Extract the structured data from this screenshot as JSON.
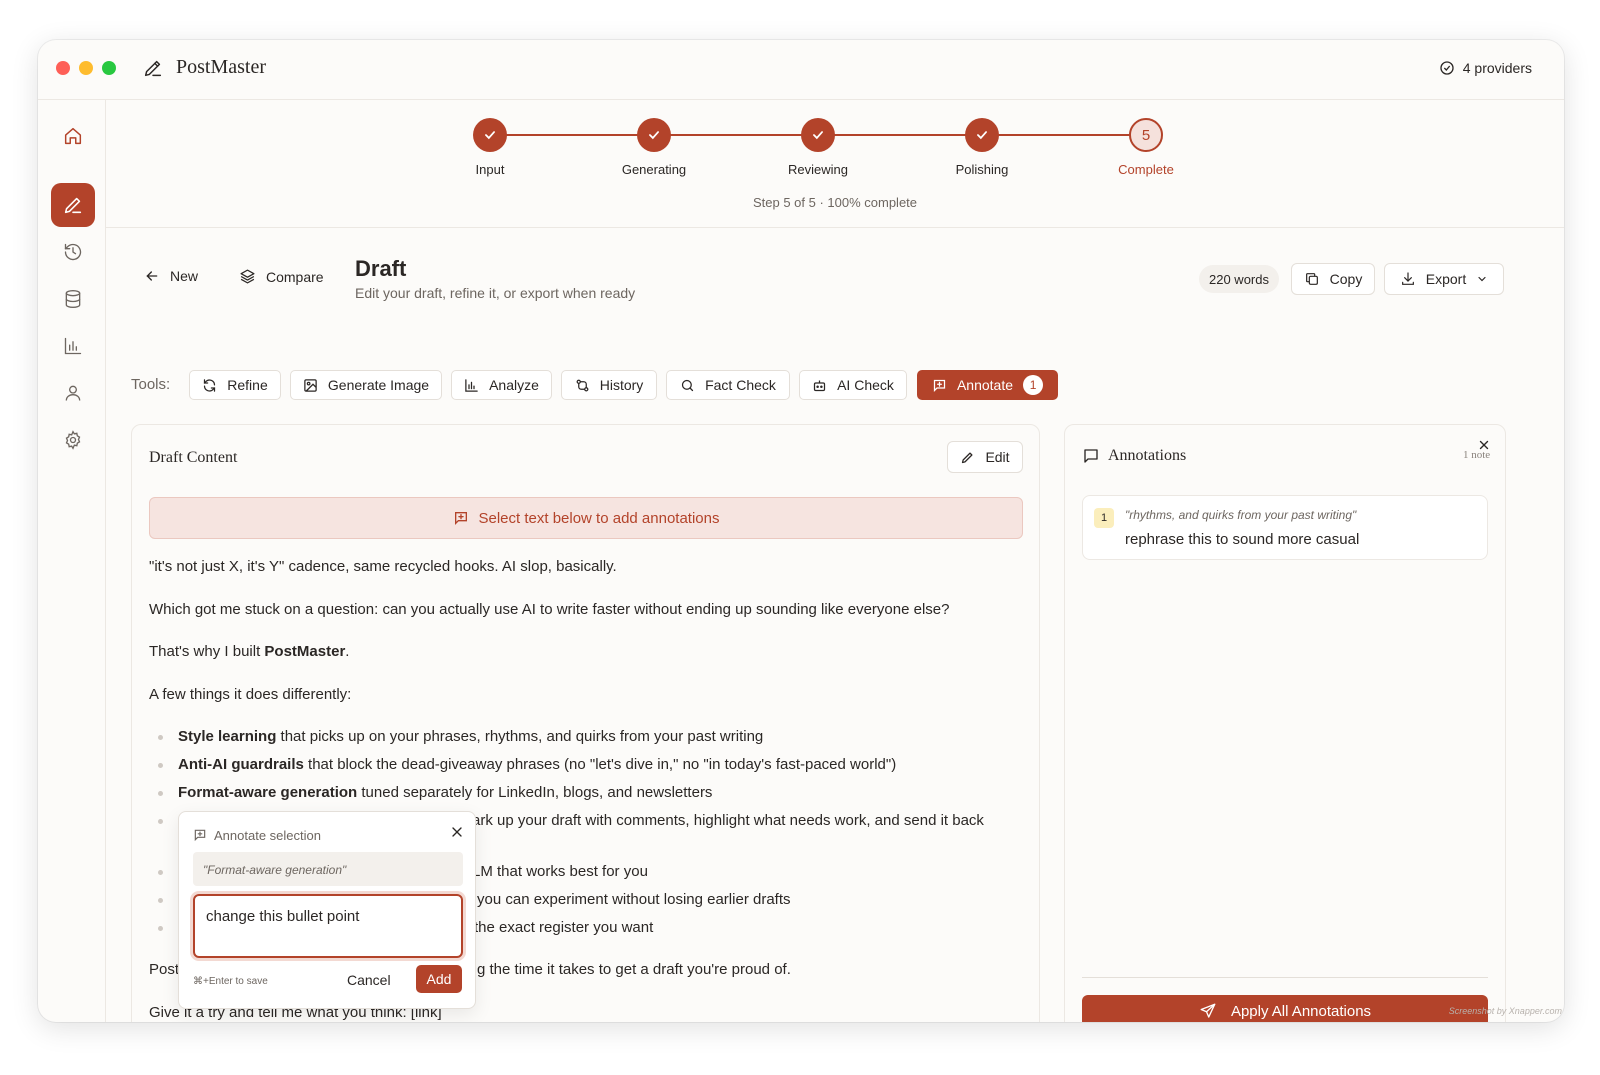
{
  "app": {
    "name": "PostMaster",
    "providers": "4 providers"
  },
  "stepper": {
    "steps": [
      {
        "label": "Input",
        "state": "done"
      },
      {
        "label": "Generating",
        "state": "done"
      },
      {
        "label": "Reviewing",
        "state": "done"
      },
      {
        "label": "Polishing",
        "state": "done"
      },
      {
        "label": "Complete",
        "state": "current",
        "number": "5"
      }
    ],
    "info": "Step 5 of 5 · 100% complete",
    "progress": 1.0
  },
  "header": {
    "new_label": "New",
    "compare_label": "Compare",
    "title": "Draft",
    "subtitle": "Edit your draft, refine it, or export when ready",
    "word_count": "220 words",
    "copy_label": "Copy",
    "export_label": "Export"
  },
  "tools": {
    "label": "Tools:",
    "items": [
      {
        "label": "Refine",
        "icon": "refresh-icon"
      },
      {
        "label": "Generate Image",
        "icon": "image-icon"
      },
      {
        "label": "Analyze",
        "icon": "bar-chart-icon"
      },
      {
        "label": "History",
        "icon": "git-compare-icon"
      },
      {
        "label": "Fact Check",
        "icon": "search-icon"
      },
      {
        "label": "AI Check",
        "icon": "bot-icon"
      },
      {
        "label": "Annotate",
        "icon": "annotate-icon",
        "active": true,
        "badge": "1"
      }
    ]
  },
  "draft": {
    "panel_title": "Draft Content",
    "edit_label": "Edit",
    "hint": "Select text below to add annotations",
    "p1": "\"it's not just X, it's Y\" cadence, same recycled hooks. AI slop, basically.",
    "p2": "Which got me stuck on a question: can you actually use AI to write faster without ending up sounding like everyone else?",
    "p3_prefix": "That's why I built ",
    "p3_bold": "PostMaster",
    "p3_suffix": ".",
    "p4": "A few things it does differently:",
    "bullets": [
      {
        "bold": "Style learning",
        "text": " that picks up on your phrases, rhythms, and quirks from your past writing"
      },
      {
        "bold": "Anti-AI guardrails",
        "text": " that block the dead-giveaway phrases (no \"let's dive in,\" no \"in today's fast-paced world\")"
      },
      {
        "bold": "Format-aware generation",
        "text": " tuned separately for LinkedIn, blogs, and newsletters"
      },
      {
        "bold": "",
        "text": "ark up your draft with comments, highlight what needs work, and send it back"
      },
      {
        "bold": "",
        "text": "LM that works best for you"
      },
      {
        "bold": "",
        "text": "you can experiment without losing earlier drafts"
      },
      {
        "bold": "",
        "text": "the exact register you want"
      }
    ],
    "p5_start": "Post",
    "p5_end": "g the time it takes to get a draft you're proud of.",
    "p6": "Give it a try and tell me what you think: [link]"
  },
  "popover": {
    "title": "Annotate selection",
    "quote": "\"Format-aware generation\"",
    "input_value": "change this bullet point",
    "hint": "⌘+Enter to save",
    "cancel_label": "Cancel",
    "add_label": "Add"
  },
  "annotations": {
    "title": "Annotations",
    "count": "1 note",
    "items": [
      {
        "number": "1",
        "quote": "\"rhythms, and quirks from your past writing\"",
        "note": "rephrase this to sound more casual"
      }
    ],
    "apply_label": "Apply All Annotations"
  },
  "credit": "Screenshot by Xnapper.com",
  "colors": {
    "accent": "#b3432a",
    "hint_bg": "#f6e4e0",
    "badge_note": "#fbeebc"
  }
}
